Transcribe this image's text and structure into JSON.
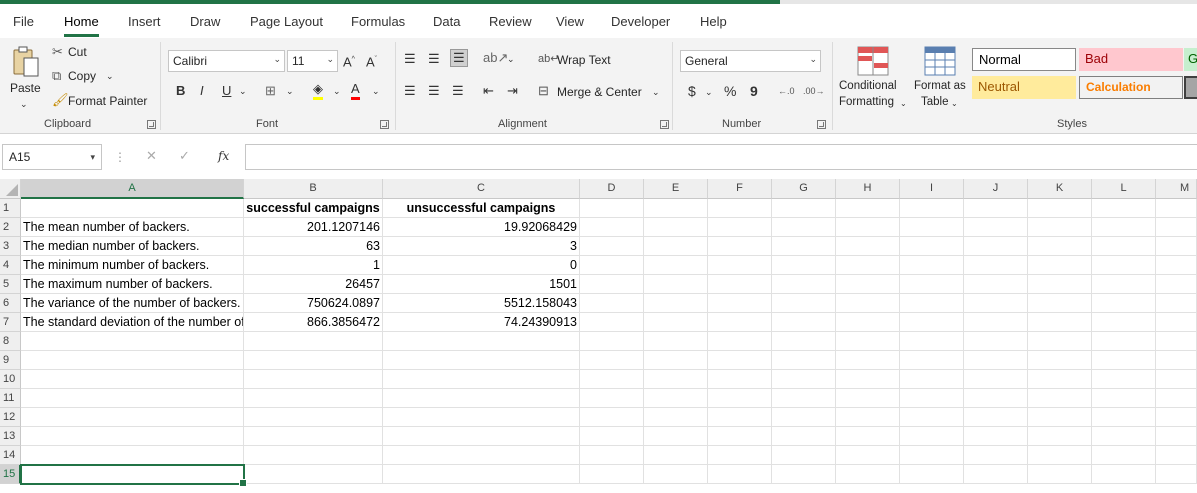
{
  "tabs": [
    "File",
    "Home",
    "Insert",
    "Draw",
    "Page Layout",
    "Formulas",
    "Data",
    "Review",
    "View",
    "Developer",
    "Help"
  ],
  "active_tab": "Home",
  "ribbon": {
    "clipboard": {
      "paste": "Paste",
      "cut": "Cut",
      "copy": "Copy",
      "format_painter": "Format Painter",
      "label": "Clipboard"
    },
    "font": {
      "name": "Calibri",
      "size": "11",
      "bold": "B",
      "italic": "I",
      "underline": "U",
      "label": "Font"
    },
    "alignment": {
      "wrap_text": "Wrap Text",
      "merge_center": "Merge & Center",
      "label": "Alignment"
    },
    "number": {
      "format": "General",
      "currency": "$",
      "percent": "%",
      "comma": "9",
      "label": "Number"
    },
    "styles": {
      "conditional_formatting": [
        "Conditional",
        "Formatting"
      ],
      "format_as_table": [
        "Format as",
        "Table"
      ],
      "normal": "Normal",
      "bad": "Bad",
      "good": "G",
      "neutral": "Neutral",
      "calculation": "Calculation",
      "label": "Styles"
    }
  },
  "formula_bar": {
    "name_box": "A15",
    "fx": "fx",
    "value": ""
  },
  "columns": [
    "A",
    "B",
    "C",
    "D",
    "E",
    "F",
    "G",
    "H",
    "I",
    "J",
    "K",
    "L",
    "M"
  ],
  "rows": [
    "1",
    "2",
    "3",
    "4",
    "5",
    "6",
    "7",
    "8",
    "9",
    "10",
    "11",
    "12",
    "13",
    "14",
    "15"
  ],
  "selected_column": "A",
  "selected_row": "15",
  "cells": {
    "header_b": "successful campaigns",
    "header_c": "unsuccessful campaigns",
    "stats": [
      {
        "label": "The mean number of backers.",
        "b": "201.1207146",
        "c": "19.92068429"
      },
      {
        "label": "The median number of backers.",
        "b": "63",
        "c": "3"
      },
      {
        "label": "The minimum number of backers.",
        "b": "1",
        "c": "0"
      },
      {
        "label": "The maximum number of backers.",
        "b": "26457",
        "c": "1501"
      },
      {
        "label": "The variance of the number of backers.",
        "b": "750624.0897",
        "c": "5512.158043"
      },
      {
        "label": "The standard deviation of the number of backers.",
        "b": "866.3856472",
        "c": "74.24390913"
      }
    ]
  },
  "colors": {
    "accent": "#217346",
    "bad_bg": "#ffc7ce",
    "bad_fg": "#9c0006",
    "neutral_bg": "#ffeb9c",
    "neutral_fg": "#9c5700",
    "calc_fg": "#fa7d00",
    "good_bg": "#c6efce"
  }
}
